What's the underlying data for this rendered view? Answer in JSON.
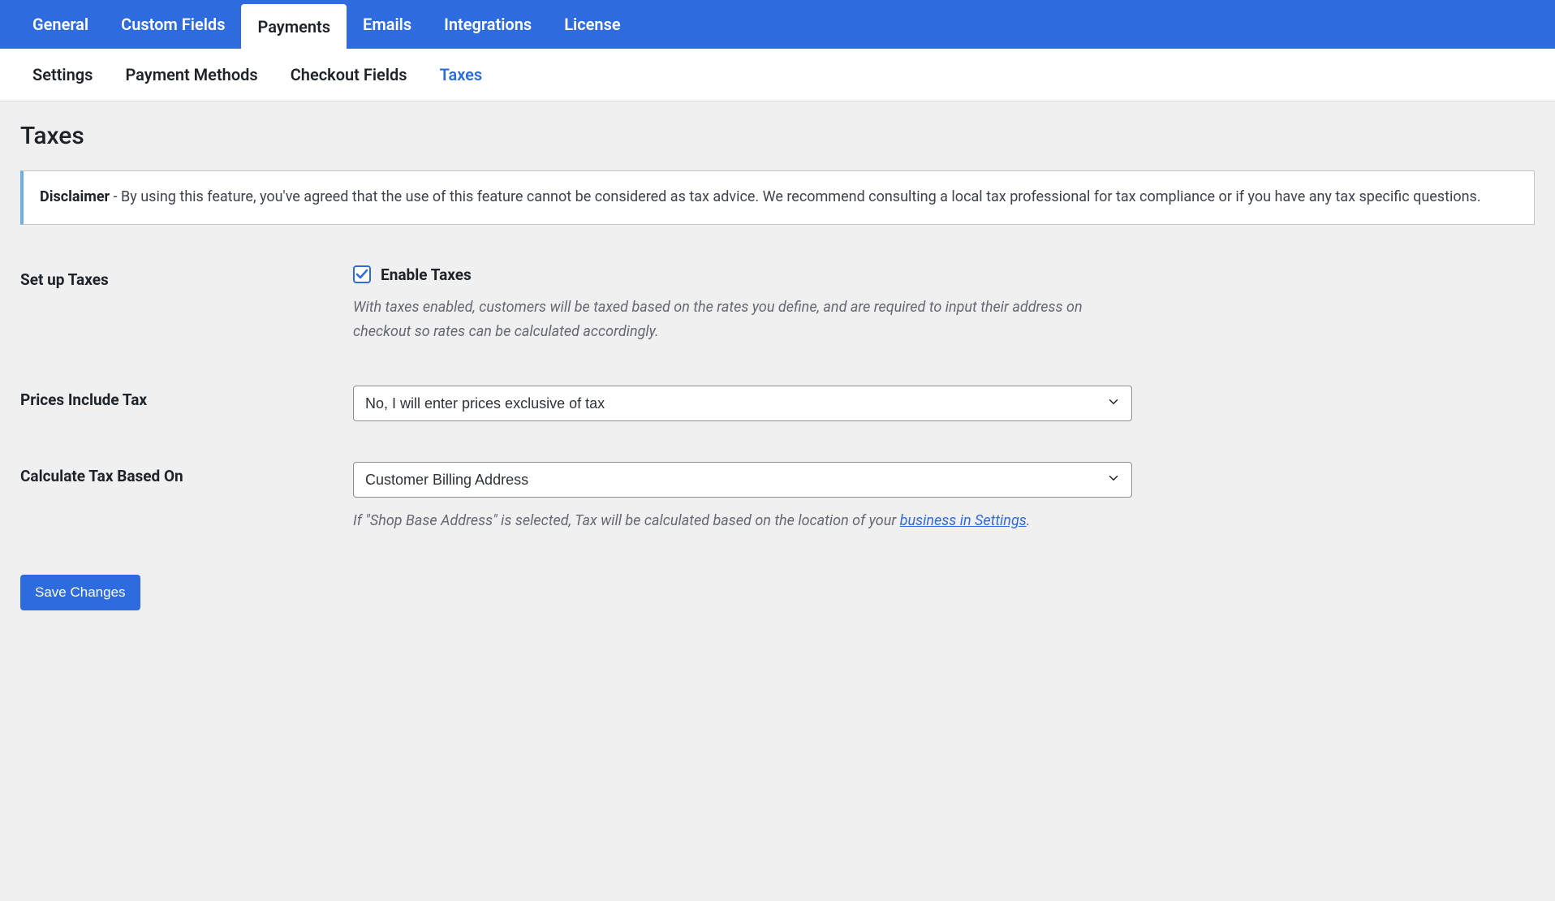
{
  "mainTabs": {
    "general": "General",
    "customFields": "Custom Fields",
    "payments": "Payments",
    "emails": "Emails",
    "integrations": "Integrations",
    "license": "License"
  },
  "subTabs": {
    "settings": "Settings",
    "paymentMethods": "Payment Methods",
    "checkoutFields": "Checkout Fields",
    "taxes": "Taxes"
  },
  "pageTitle": "Taxes",
  "disclaimer": {
    "label": "Disclaimer",
    "text": " - By using this feature, you've agreed that the use of this feature cannot be considered as tax advice. We recommend consulting a local tax professional for tax compliance or if you have any tax specific questions."
  },
  "fields": {
    "setupTaxes": {
      "label": "Set up Taxes",
      "checkboxLabel": "Enable Taxes",
      "checked": true,
      "description": "With taxes enabled, customers will be taxed based on the rates you define, and are required to input their address on checkout so rates can be calculated accordingly."
    },
    "pricesIncludeTax": {
      "label": "Prices Include Tax",
      "value": "No, I will enter prices exclusive of tax"
    },
    "calculateTaxBasedOn": {
      "label": "Calculate Tax Based On",
      "value": "Customer Billing Address",
      "descriptionPrefix": "If \"Shop Base Address\" is selected, Tax will be calculated based on the location of your ",
      "linkText": "business in Settings",
      "descriptionSuffix": "."
    }
  },
  "saveButton": "Save Changes"
}
